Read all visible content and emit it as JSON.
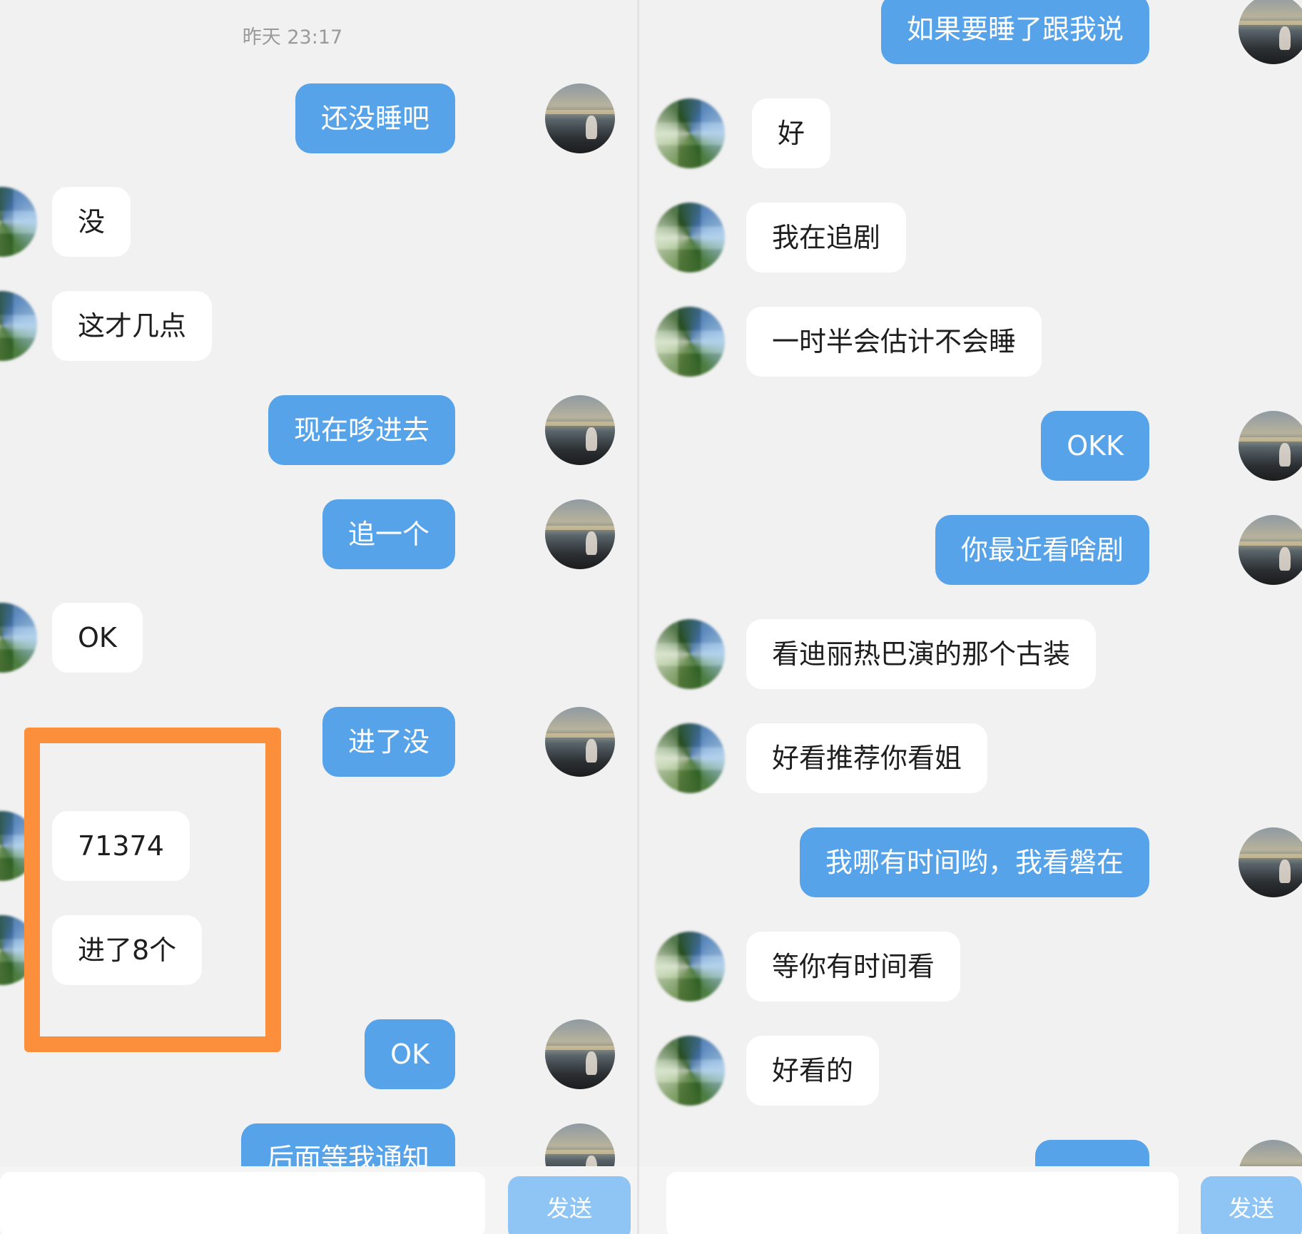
{
  "left_pane": {
    "timestamp": "昨天 23:17",
    "messages": [
      {
        "side": "out",
        "text": "还没睡吧"
      },
      {
        "side": "in",
        "text": "没"
      },
      {
        "side": "in",
        "text": "这才几点"
      },
      {
        "side": "out",
        "text": "现在哆进去"
      },
      {
        "side": "out",
        "text": "追一个"
      },
      {
        "side": "in",
        "text": "OK"
      },
      {
        "side": "out",
        "text": "进了没"
      },
      {
        "side": "in",
        "text": "71374"
      },
      {
        "side": "in",
        "text": "进了8个"
      },
      {
        "side": "out",
        "text": "OK"
      },
      {
        "side": "out",
        "text": "后面等我通知"
      }
    ],
    "send_label": "发送"
  },
  "right_pane": {
    "messages": [
      {
        "side": "out",
        "text": "如果要睡了跟我说"
      },
      {
        "side": "in",
        "text": "好"
      },
      {
        "side": "in",
        "text": "我在追剧"
      },
      {
        "side": "in",
        "text": "一时半会估计不会睡"
      },
      {
        "side": "out",
        "text": "OKK"
      },
      {
        "side": "out",
        "text": "你最近看啥剧"
      },
      {
        "side": "in",
        "text": "看迪丽热巴演的那个古装"
      },
      {
        "side": "in",
        "text": "好看推荐你看姐"
      },
      {
        "side": "out",
        "text": "我哪有时间哟，我看磐在"
      },
      {
        "side": "in",
        "text": "等你有时间看"
      },
      {
        "side": "in",
        "text": "好看的"
      },
      {
        "side": "out",
        "text": ""
      }
    ],
    "send_label": "发送"
  },
  "colors": {
    "outgoing_bubble": "#56a3ea",
    "incoming_bubble": "#ffffff",
    "background": "#f1f1f1",
    "highlight_box": "#fb8f3b",
    "send_button": "#8ec5f5"
  }
}
